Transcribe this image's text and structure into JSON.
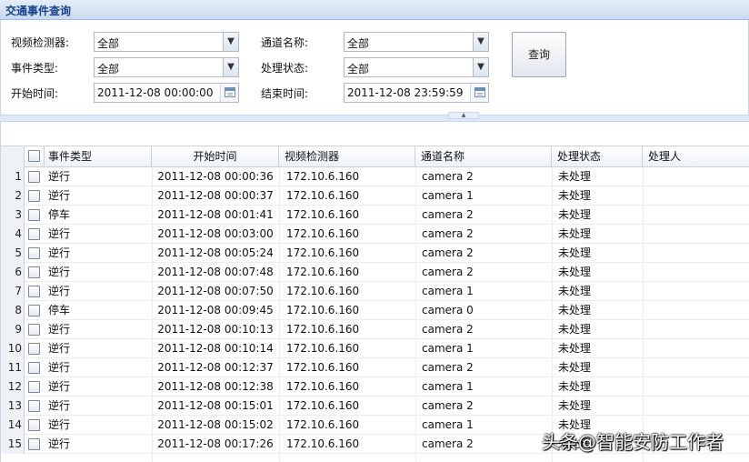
{
  "panel_title": "交通事件查询",
  "form": {
    "video_detector": {
      "label": "视频检测器:",
      "value": "全部"
    },
    "channel_name": {
      "label": "通道名称:",
      "value": "全部"
    },
    "event_type": {
      "label": "事件类型:",
      "value": "全部"
    },
    "process_status": {
      "label": "处理状态:",
      "value": "全部"
    },
    "start_time": {
      "label": "开始时间:",
      "value": "2011-12-08 00:00:00"
    },
    "end_time": {
      "label": "结束时间:",
      "value": "2011-12-08 23:59:59"
    },
    "query_button": "查询"
  },
  "grid": {
    "columns": [
      "事件类型",
      "开始时间",
      "视频检测器",
      "通道名称",
      "处理状态",
      "处理人"
    ],
    "rows": [
      {
        "num": "1",
        "type": "逆行",
        "start": "2011-12-08 00:00:36",
        "detector": "172.10.6.160",
        "channel": "camera 2",
        "status": "未处理",
        "handler": ""
      },
      {
        "num": "2",
        "type": "逆行",
        "start": "2011-12-08 00:00:37",
        "detector": "172.10.6.160",
        "channel": "camera 1",
        "status": "未处理",
        "handler": ""
      },
      {
        "num": "3",
        "type": "停车",
        "start": "2011-12-08 00:01:41",
        "detector": "172.10.6.160",
        "channel": "camera 2",
        "status": "未处理",
        "handler": ""
      },
      {
        "num": "4",
        "type": "逆行",
        "start": "2011-12-08 00:03:00",
        "detector": "172.10.6.160",
        "channel": "camera 2",
        "status": "未处理",
        "handler": ""
      },
      {
        "num": "5",
        "type": "逆行",
        "start": "2011-12-08 00:05:24",
        "detector": "172.10.6.160",
        "channel": "camera 2",
        "status": "未处理",
        "handler": ""
      },
      {
        "num": "6",
        "type": "逆行",
        "start": "2011-12-08 00:07:48",
        "detector": "172.10.6.160",
        "channel": "camera 2",
        "status": "未处理",
        "handler": ""
      },
      {
        "num": "7",
        "type": "逆行",
        "start": "2011-12-08 00:07:50",
        "detector": "172.10.6.160",
        "channel": "camera 1",
        "status": "未处理",
        "handler": ""
      },
      {
        "num": "8",
        "type": "停车",
        "start": "2011-12-08 00:09:45",
        "detector": "172.10.6.160",
        "channel": "camera 0",
        "status": "未处理",
        "handler": ""
      },
      {
        "num": "9",
        "type": "逆行",
        "start": "2011-12-08 00:10:13",
        "detector": "172.10.6.160",
        "channel": "camera 2",
        "status": "未处理",
        "handler": ""
      },
      {
        "num": "10",
        "type": "逆行",
        "start": "2011-12-08 00:10:14",
        "detector": "172.10.6.160",
        "channel": "camera 1",
        "status": "未处理",
        "handler": ""
      },
      {
        "num": "11",
        "type": "逆行",
        "start": "2011-12-08 00:12:37",
        "detector": "172.10.6.160",
        "channel": "camera 2",
        "status": "未处理",
        "handler": ""
      },
      {
        "num": "12",
        "type": "逆行",
        "start": "2011-12-08 00:12:38",
        "detector": "172.10.6.160",
        "channel": "camera 1",
        "status": "未处理",
        "handler": ""
      },
      {
        "num": "13",
        "type": "逆行",
        "start": "2011-12-08 00:15:01",
        "detector": "172.10.6.160",
        "channel": "camera 2",
        "status": "未处理",
        "handler": ""
      },
      {
        "num": "14",
        "type": "逆行",
        "start": "2011-12-08 00:15:02",
        "detector": "172.10.6.160",
        "channel": "camera 1",
        "status": "未处理",
        "handler": ""
      },
      {
        "num": "15",
        "type": "逆行",
        "start": "2011-12-08 00:17:26",
        "detector": "172.10.6.160",
        "channel": "camera 2",
        "status": "未处理",
        "handler": ""
      }
    ]
  },
  "watermark": "头条@智能安防工作者",
  "icons": {
    "combo_trigger": "chevron-down-icon",
    "date_trigger": "calendar-icon"
  }
}
